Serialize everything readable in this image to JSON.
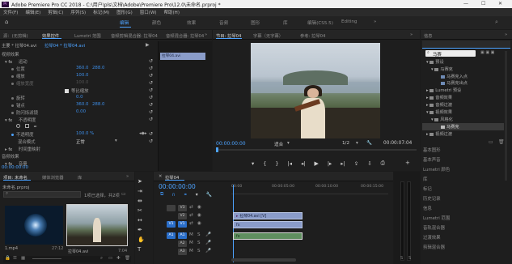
{
  "app": {
    "title": "Adobe Premiere Pro CC 2018 - C:\\用户\\pls\\文档\\Adobe\\Premiere Pro\\12.0\\未命名.prproj *",
    "icon_label": "Pr"
  },
  "menu": [
    "文件(F)",
    "编辑(E)",
    "剪辑(C)",
    "序列(S)",
    "标记(M)",
    "图形(G)",
    "窗口(W)",
    "帮助(H)"
  ],
  "workspaces": {
    "items": [
      "编辑",
      "颜色",
      "效果",
      "音频",
      "图形",
      "库",
      "编辑(CS5.5)",
      "Editing"
    ],
    "active_index": 0,
    "more": "»"
  },
  "effect_controls": {
    "tabs": [
      "源：(无剪辑)",
      "效果控件",
      "Lumetri 范围",
      "音频剪辑混合器: 拉琴04",
      "音频混合器: 拉琴04"
    ],
    "active_tab": 1,
    "more": "»",
    "master_label": "主要 * 拉琴04.avi",
    "clip_label": "拉琴04 * 拉琴04.avi",
    "mini_clip": "拉琴04.avi",
    "sections": {
      "video_effects": "视频效果",
      "motion": "运动",
      "position": "位置",
      "position_x": "360.0",
      "position_y": "288.0",
      "scale": "缩放",
      "scale_value": "100.0",
      "scale_width": "缩放宽度",
      "scale_width_value": "100.0",
      "uniform_scale": "等比缩放",
      "rotation": "旋转",
      "rotation_value": "0.0",
      "anchor": "锚点",
      "anchor_x": "360.0",
      "anchor_y": "288.0",
      "antiflicker": "防闪烁滤镜",
      "antiflicker_value": "0.00",
      "opacity": "不透明度",
      "opacity_label": "不透明度",
      "opacity_value": "100.0 %",
      "blend_label": "混合模式",
      "blend_value": "正常",
      "time_remap": "时间重映射",
      "audio_effects": "音频效果",
      "volume": "音量"
    },
    "timecode": "00:00:00:00"
  },
  "program_monitor": {
    "tabs": [
      "节目: 拉琴04",
      "字幕（无字幕）",
      "参考: 拉琴04"
    ],
    "active_tab": 0,
    "more": "»",
    "timecode": "00:00:00:00",
    "fit": "适合",
    "resolution": "1/2",
    "duration": "00:00:07:04"
  },
  "project_panel": {
    "tabs": [
      "项目: 未命名",
      "媒体浏览器",
      "库"
    ],
    "active_tab": 0,
    "more": "»",
    "project_file": "未命名.prproj",
    "search_placeholder": "",
    "item_count": "1项已选择，共2项",
    "items": [
      {
        "name": "1.mp4",
        "duration": "27:12"
      },
      {
        "name": "拉琴04.avi",
        "duration": "7:04"
      }
    ]
  },
  "timeline": {
    "tab": "拉琴04",
    "timecode": "00:00:00:00",
    "ruler": [
      "00:00",
      "00:00:05:00",
      "00:00:10:00",
      "00:00:15:00"
    ],
    "video_tracks": [
      "V3",
      "V2",
      "V1"
    ],
    "audio_tracks": [
      "A1",
      "A2",
      "A3"
    ],
    "source_v": "V1",
    "source_a": "A1",
    "clips": {
      "video": "拉琴04.avi [V]",
      "video_fx": "fx",
      "audio": "fx"
    }
  },
  "effects_panel": {
    "tabs": [
      "信息",
      "效果"
    ],
    "active_tab": 1,
    "more": "»",
    "search_value": "马赛",
    "tree": [
      {
        "label": "预设",
        "depth": 0
      },
      {
        "label": "马赛克",
        "depth": 1
      },
      {
        "label": "马赛克入点",
        "depth": 2
      },
      {
        "label": "马赛克出点",
        "depth": 2
      },
      {
        "label": "Lumetri 预设",
        "depth": 0
      },
      {
        "label": "音频效果",
        "depth": 0
      },
      {
        "label": "音频过渡",
        "depth": 0
      },
      {
        "label": "视频效果",
        "depth": 0
      },
      {
        "label": "风格化",
        "depth": 1
      },
      {
        "label": "马赛克",
        "depth": 2
      },
      {
        "label": "视频过渡",
        "depth": 0
      }
    ],
    "selected_index": 9,
    "other_panels": [
      "基本图形",
      "基本声音",
      "Lumetri 颜色",
      "库",
      "标记",
      "历史记录",
      "信息",
      "Lumetri 范围",
      "音轨混合器",
      "过渡效果",
      "剪辑混合器"
    ]
  },
  "colors": {
    "accent_blue": "#4da3ff",
    "selected_blue": "#2a6ec9",
    "video_clip": "#8a9cc9",
    "audio_clip": "#5f8f5f"
  }
}
